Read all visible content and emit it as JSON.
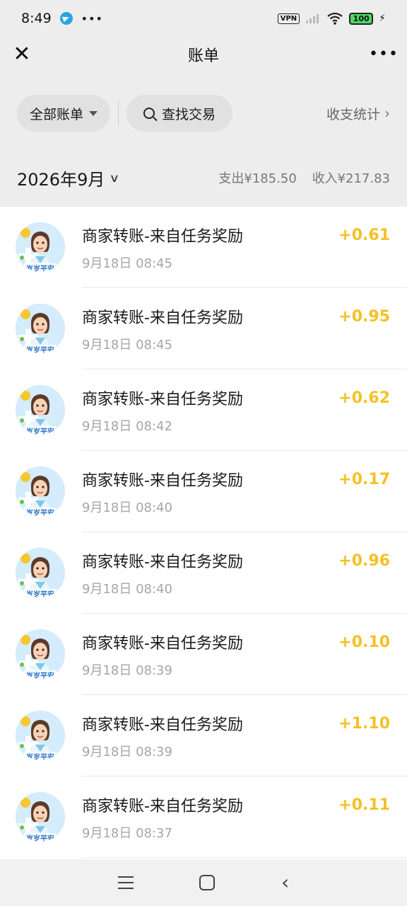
{
  "status_bar": {
    "time": "8:49",
    "dots": "•••",
    "vpn": "VPN",
    "battery": "100"
  },
  "nav": {
    "title": "账单",
    "more": "•••"
  },
  "filters": {
    "all_bills": "全部账单",
    "search": "查找交易",
    "stats": "收支统计"
  },
  "month": {
    "label": "2026年9月",
    "expense": "支出¥185.50",
    "income": "收入¥217.83"
  },
  "transactions": [
    {
      "title": "商家转账-来自任务奖励",
      "time": "9月18日 08:45",
      "amount": "+0.61"
    },
    {
      "title": "商家转账-来自任务奖励",
      "time": "9月18日 08:45",
      "amount": "+0.95"
    },
    {
      "title": "商家转账-来自任务奖励",
      "time": "9月18日 08:42",
      "amount": "+0.62"
    },
    {
      "title": "商家转账-来自任务奖励",
      "time": "9月18日 08:40",
      "amount": "+0.17"
    },
    {
      "title": "商家转账-来自任务奖励",
      "time": "9月18日 08:40",
      "amount": "+0.96"
    },
    {
      "title": "商家转账-来自任务奖励",
      "time": "9月18日 08:39",
      "amount": "+0.10"
    },
    {
      "title": "商家转账-来自任务奖励",
      "time": "9月18日 08:39",
      "amount": "+1.10"
    },
    {
      "title": "商家转账-来自任务奖励",
      "time": "9月18日 08:37",
      "amount": "+0.11"
    }
  ],
  "avatar_caption": "岁岁平安",
  "colors": {
    "income_amount": "#f4c125",
    "background": "#ededed"
  }
}
